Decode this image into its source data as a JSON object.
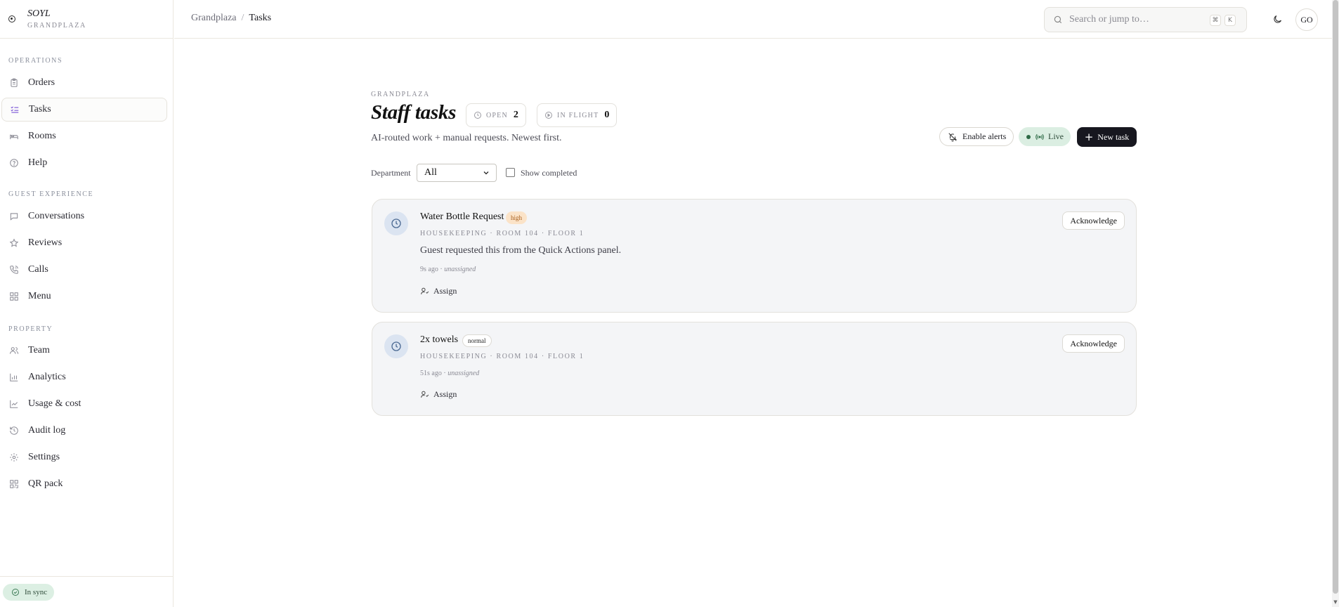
{
  "brand": {
    "name": "SOYL",
    "property": "GRANDPLAZA"
  },
  "sidebar": {
    "sections": [
      {
        "title": "OPERATIONS",
        "items": [
          {
            "label": "Orders",
            "icon": "clipboard-icon"
          },
          {
            "label": "Tasks",
            "icon": "list-checks-icon",
            "active": true
          },
          {
            "label": "Rooms",
            "icon": "bed-icon"
          },
          {
            "label": "Help",
            "icon": "help-circle-icon"
          }
        ]
      },
      {
        "title": "GUEST EXPERIENCE",
        "items": [
          {
            "label": "Conversations",
            "icon": "chat-bubble-icon"
          },
          {
            "label": "Reviews",
            "icon": "star-icon"
          },
          {
            "label": "Calls",
            "icon": "phone-icon"
          },
          {
            "label": "Menu",
            "icon": "grid-icon"
          }
        ]
      },
      {
        "title": "PROPERTY",
        "items": [
          {
            "label": "Team",
            "icon": "users-icon"
          },
          {
            "label": "Analytics",
            "icon": "bar-chart-icon"
          },
          {
            "label": "Usage & cost",
            "icon": "line-chart-icon"
          },
          {
            "label": "Audit log",
            "icon": "history-icon"
          },
          {
            "label": "Settings",
            "icon": "gear-icon"
          },
          {
            "label": "QR pack",
            "icon": "qr-code-icon"
          }
        ]
      }
    ],
    "sync_status": "In sync"
  },
  "topbar": {
    "breadcrumb": [
      "Grandplaza",
      "Tasks"
    ],
    "search_placeholder": "Search or jump to…",
    "shortcut_keys": [
      "⌘",
      "K"
    ],
    "avatar_initials": "GO"
  },
  "page": {
    "eyebrow": "GRANDPLAZA",
    "title": "Staff tasks",
    "subtitle": "AI-routed work + manual requests. Newest first.",
    "stats": [
      {
        "label": "OPEN",
        "value": "2"
      },
      {
        "label": "IN FLIGHT",
        "value": "0"
      }
    ],
    "actions": {
      "enable_alerts": "Enable alerts",
      "live": "Live",
      "new_task": "New task"
    },
    "filters": {
      "department_label": "Department",
      "department_value": "All",
      "show_completed_label": "Show completed",
      "show_completed_checked": false
    }
  },
  "tasks": [
    {
      "title": "Water Bottle Request",
      "priority": "high",
      "meta": "HOUSEKEEPING · ROOM 104 · FLOOR 1",
      "description": "Guest requested this from the Quick Actions panel.",
      "age": "9s ago",
      "assignee": "unassigned",
      "assign_label": "Assign",
      "ack_label": "Acknowledge"
    },
    {
      "title": "2x towels",
      "priority": "normal",
      "meta": "HOUSEKEEPING · ROOM 104 · FLOOR 1",
      "description": "",
      "age": "51s ago",
      "assignee": "unassigned",
      "assign_label": "Assign",
      "ack_label": "Acknowledge"
    }
  ],
  "colors": {
    "accent": "#7a54d6",
    "primary_button": "#17171f",
    "live_bg": "#dbeee2",
    "high_priority_bg": "#fbe3c8",
    "card_bg": "#f4f5f7"
  }
}
